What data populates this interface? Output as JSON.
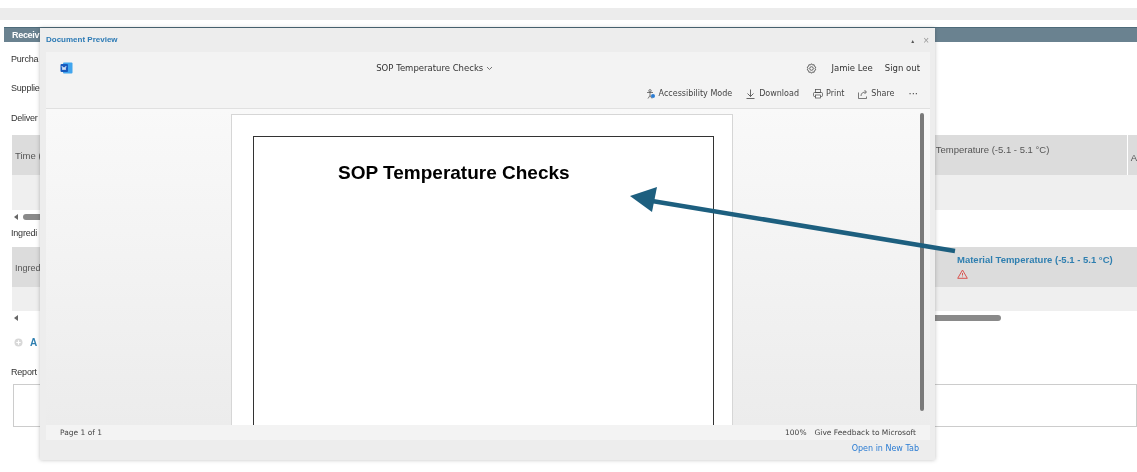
{
  "background_page": {
    "header": "Receiv",
    "fields": [
      "Purcha",
      "Supplie"
    ],
    "delivery_label": "Deliver",
    "delivery_table": {
      "columns": [
        "Time (",
        "Temperature (-5.1 - 5.1 °C)",
        "A"
      ]
    },
    "ingredients_label": "Ingredi",
    "ingredients_table": {
      "columns": [
        {
          "label": "Ingred",
          "link": false,
          "warning": false
        },
        {
          "label": "Material Temperature (-5.1 - 5.1 °C)",
          "link": true,
          "warning": true
        }
      ]
    },
    "add_link": "A",
    "report_label": "Report"
  },
  "dialog": {
    "title": "Document Preview",
    "minimize": "▲",
    "close": "×",
    "app": {
      "document_title": "SOP Temperature Checks",
      "user": "Jamie Lee",
      "sign_out": "Sign out",
      "commands": [
        {
          "label": "Accessibility Mode",
          "kind": "accessibility"
        },
        {
          "label": "Download",
          "kind": "download"
        },
        {
          "label": "Print",
          "kind": "print"
        },
        {
          "label": "Share",
          "kind": "share"
        },
        {
          "label": "···",
          "kind": "more"
        }
      ]
    },
    "document": {
      "heading": "SOP Temperature Checks"
    },
    "status": {
      "page": "Page 1 of 1",
      "zoom": "100%",
      "feedback": "Give Feedback to Microsoft"
    },
    "open_link": "Open in New Tab"
  }
}
